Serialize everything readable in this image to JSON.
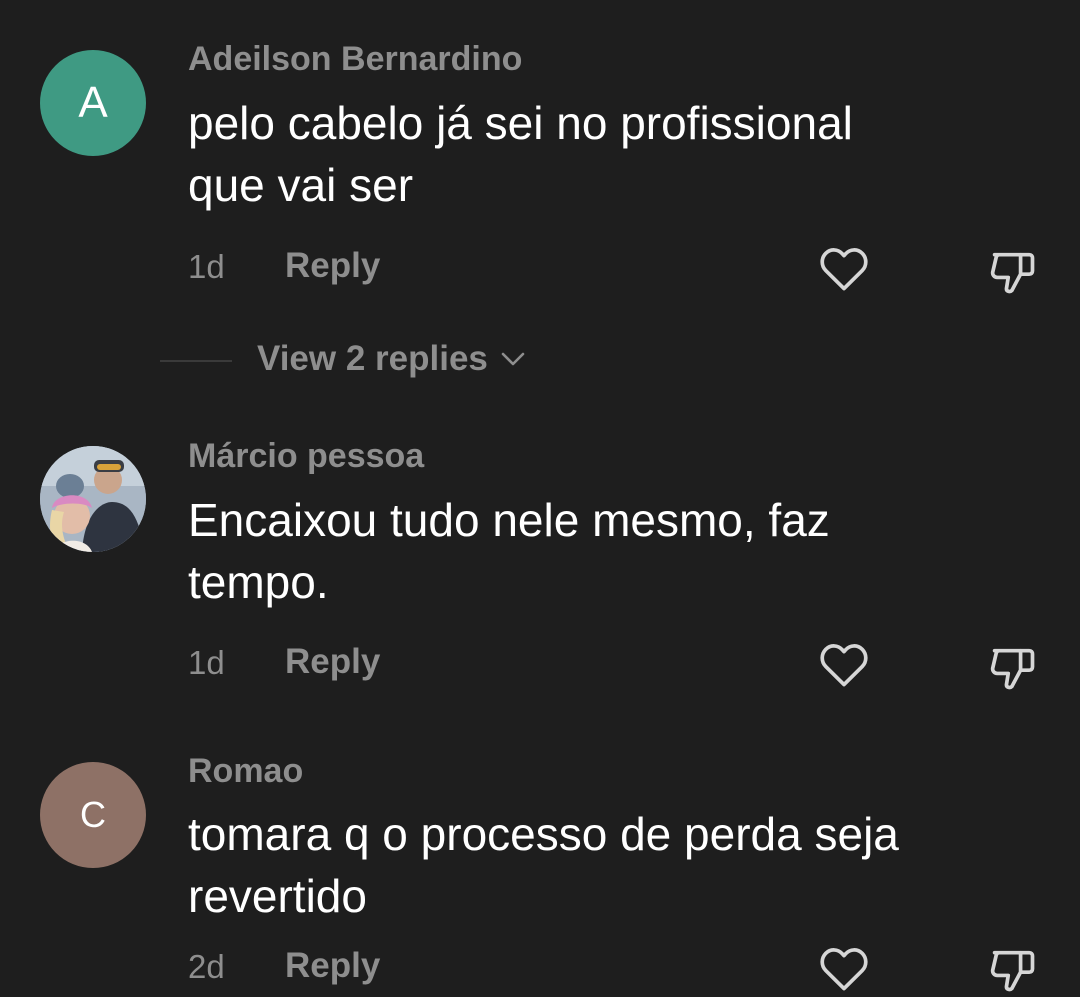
{
  "comments": [
    {
      "avatar_letter": "A",
      "avatar_color": "#3f9a83",
      "username": "Adeilson Bernardino",
      "text_line1": "pelo cabelo já sei no profissional",
      "text_line2": "que vai ser",
      "time": "1d",
      "reply_label": "Reply"
    },
    {
      "avatar_letter": "",
      "username": "Márcio pessoa",
      "text_line1": "Encaixou tudo nele mesmo, faz",
      "text_line2": "tempo.",
      "time": "1d",
      "reply_label": "Reply"
    },
    {
      "avatar_letter": "C",
      "avatar_color": "#8e7166",
      "username": "Romao",
      "text_line1": "tomara q o processo de perda seja",
      "text_line2": "revertido",
      "time": "2d",
      "reply_label": "Reply"
    }
  ],
  "view_replies_label": "View 2 replies",
  "icons": {
    "like": "heart-outline-icon",
    "dislike": "thumbs-down-outline-icon",
    "expand": "chevron-down-icon"
  },
  "colors": {
    "background": "#1e1e1e",
    "secondary_text": "#8e8e8e",
    "primary_text": "#ffffff"
  }
}
